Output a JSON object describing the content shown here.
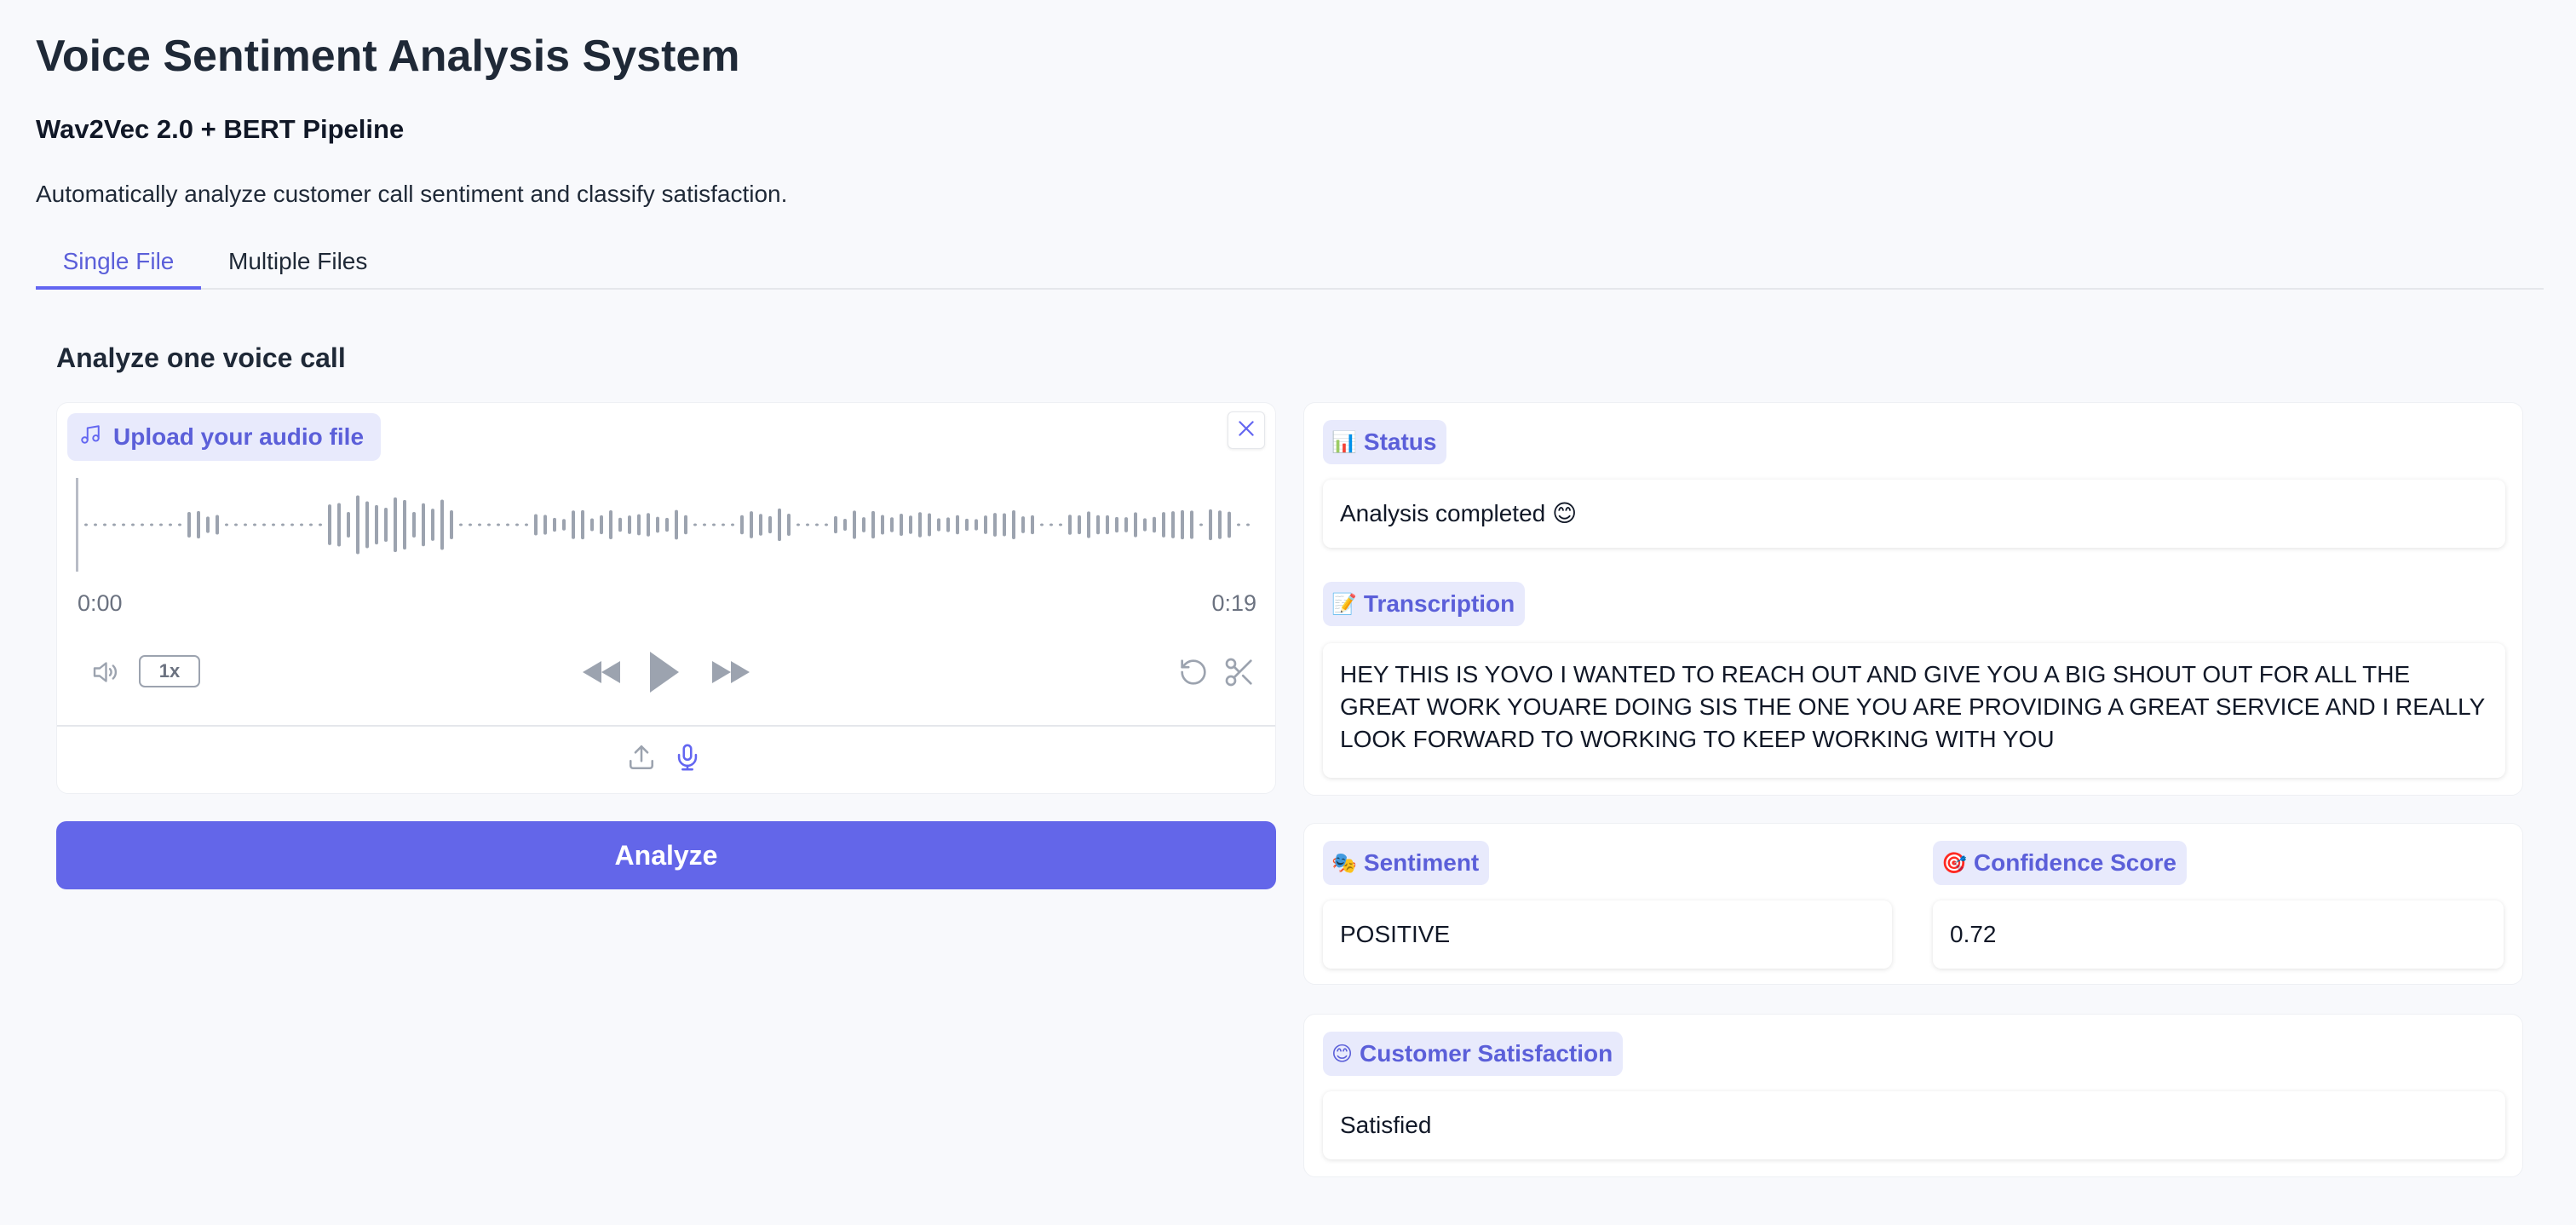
{
  "app": {
    "title": "Voice Sentiment Analysis System",
    "subtitle": "Wav2Vec 2.0 + BERT Pipeline",
    "description": "Automatically analyze customer call sentiment and classify satisfaction."
  },
  "tabs": [
    {
      "label": "Single File",
      "active": true
    },
    {
      "label": "Multiple Files",
      "active": false
    }
  ],
  "section_title": "Analyze one voice call",
  "audio": {
    "upload_label": "Upload your audio file",
    "time_start": "0:00",
    "time_end": "0:19",
    "speed": "1x"
  },
  "analyze_button": "Analyze",
  "results": {
    "status": {
      "label": "Status",
      "icon": "📊",
      "value": "Analysis completed 😊"
    },
    "transcription": {
      "label": "Transcription",
      "icon": "📝",
      "value": "HEY THIS IS YOVO I WANTED TO REACH OUT AND GIVE YOU A BIG SHOUT OUT FOR ALL THE GREAT WORK YOUARE DOING SIS THE ONE YOU ARE PROVIDING A GREAT SERVICE AND I REALLY LOOK FORWARD TO WORKING TO KEEP WORKING WITH YOU"
    },
    "sentiment": {
      "label": "Sentiment",
      "icon": "🎭",
      "value": "POSITIVE"
    },
    "confidence": {
      "label": "Confidence Score",
      "icon": "🎯",
      "value": "0.72"
    },
    "satisfaction": {
      "label": "Customer Satisfaction",
      "icon": "😊",
      "value": "Satisfied"
    }
  },
  "colors": {
    "accent": "#6366f1",
    "accent_text": "#5b5fd9",
    "pill_bg": "#e8eafc",
    "waveform": "#9ca3af"
  }
}
